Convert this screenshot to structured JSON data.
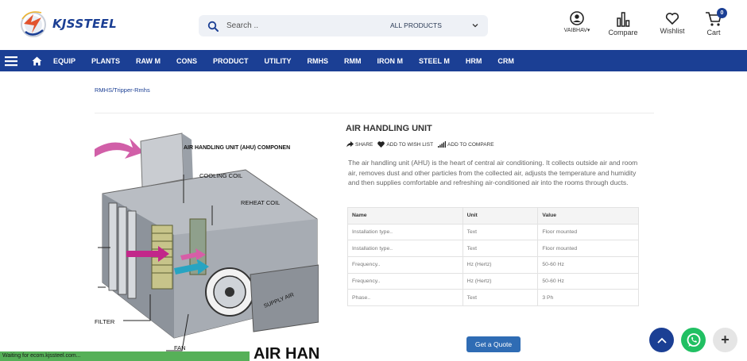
{
  "header": {
    "brand": "KJSSTEEL",
    "search": {
      "placeholder": "Search ..",
      "category": "ALL PRODUCTS"
    },
    "user_label": "VAIBHAV",
    "compare_label": "Compare",
    "wishlist_label": "Wishlist",
    "cart_label": "Cart",
    "cart_count": "0"
  },
  "nav": {
    "items": [
      "EQUIP",
      "PLANTS",
      "RAW M",
      "CONS",
      "PRODUCT",
      "UTILITY",
      "RMHS",
      "RMM",
      "IRON M",
      "STEEL M",
      "HRM",
      "CRM"
    ]
  },
  "breadcrumb": "RMHS/Tripper-Rmhs",
  "image_text": {
    "heading": "AIR HANDLING UNIT (AHU) COMPONEN",
    "cooling": "COOLING COIL",
    "reheat": "REHEAT COIL",
    "supply": "SUPPLY AIR",
    "filter": "FILTER",
    "fan": "FAN",
    "big": "AIR HAN"
  },
  "product": {
    "title": "AIR HANDLING UNIT",
    "actions": {
      "share": "SHARE",
      "wish": "ADD TO WISH LIST",
      "compare": "ADD TO COMPARE"
    },
    "description": "The air handling unit (AHU) is the heart of central air conditioning. It collects outside air and room air, removes dust and other particles from the collected air, adjusts the temperature and humidity and then supplies comfortable and refreshing air-conditioned air into the rooms through ducts.",
    "spec_headers": [
      "Name",
      "Unit",
      "Value"
    ],
    "spec_rows": [
      [
        "Installation type..",
        "Text",
        "Floor mounted"
      ],
      [
        "Installation type..",
        "Text",
        "Floor mounted"
      ],
      [
        "Frequency..",
        "Hz (Hertz)",
        "50-60 Hz"
      ],
      [
        "Frequency..",
        "Hz (Hertz)",
        "50-60 Hz"
      ],
      [
        "Phase..",
        "Text",
        "3 Ph"
      ]
    ],
    "quote_label": "Get a Quote"
  },
  "status_text": "Waiting for ecom.kjssteel.com...",
  "colors": {
    "brand": "#1b3f94",
    "button": "#2f6cb4",
    "whatsapp": "#21c063",
    "status": "#56b058"
  }
}
